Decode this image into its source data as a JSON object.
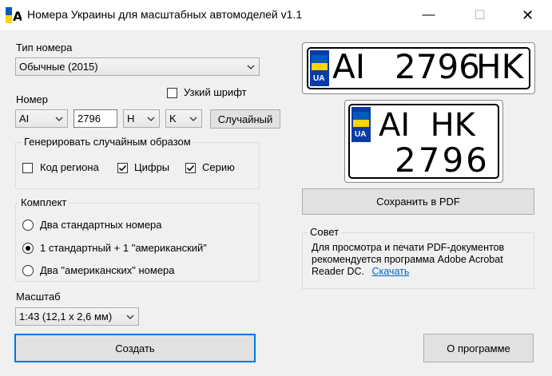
{
  "window": {
    "title": "Номера Украины для масштабных автомоделей v1.1",
    "minimize": "—",
    "maximize": "☐",
    "close": "✕"
  },
  "left": {
    "type_label": "Тип номера",
    "type_value": "Обычные (2015)",
    "narrow_font_label": "Узкий шрифт",
    "narrow_font_checked": false,
    "number_label": "Номер",
    "region_value": "AI",
    "digits_value": "2796",
    "series1_value": "H",
    "series2_value": "K",
    "random_button": "Случайный",
    "random_group_label": "Генерировать случайным образом",
    "random_options": [
      {
        "label": "Код региона",
        "checked": false
      },
      {
        "label": "Цифры",
        "checked": true
      },
      {
        "label": "Серию",
        "checked": true
      }
    ],
    "kit_label": "Комплект",
    "kit_options": [
      {
        "label": "Два стандартных номера",
        "selected": false
      },
      {
        "label": "1 стандартный + 1 \"американский\"",
        "selected": true
      },
      {
        "label": "Два \"американских\" номера",
        "selected": false
      }
    ],
    "scale_label": "Масштаб",
    "scale_value": "1:43 (12,1 x 2,6 мм)",
    "create_button": "Создать"
  },
  "right": {
    "plate_standard": {
      "region": "AI",
      "digits": "2796",
      "series": "HK",
      "country": "UA"
    },
    "plate_american": {
      "top": "AI  HK",
      "bottom": "2796",
      "country": "UA"
    },
    "save_pdf_button": "Сохранить в PDF",
    "tip_label": "Совет",
    "tip_lines": [
      "Для просмотра и печати PDF-документов",
      "рекомендуется программа Adobe Acrobat",
      "Reader DC."
    ],
    "tip_link": "Скачать",
    "about_button": "О программе"
  },
  "colors": {
    "ua_blue": "#005bbb",
    "ua_yellow": "#ffd500",
    "strip_blue": "#0a3aa6",
    "accent": "#0078d7"
  }
}
